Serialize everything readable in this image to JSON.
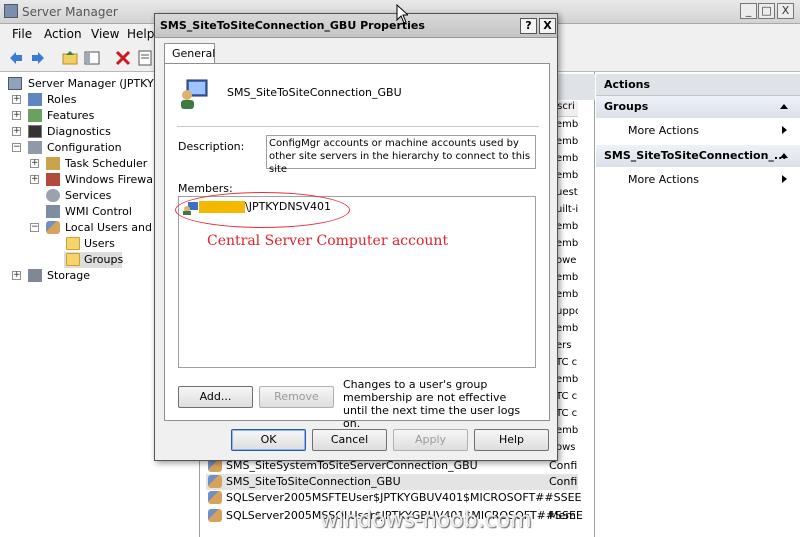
{
  "window": {
    "title": "Server Manager",
    "controls": {
      "minimize": "_",
      "maximize": "□",
      "close": "X"
    }
  },
  "menu": [
    "File",
    "Action",
    "View",
    "Help"
  ],
  "tree": {
    "root": "Server Manager (JPTKYGB",
    "items": {
      "roles": "Roles",
      "features": "Features",
      "diagnostics": "Diagnostics",
      "configuration": "Configuration",
      "task_scheduler": "Task Scheduler",
      "firewall": "Windows Firewall w",
      "services": "Services",
      "wmi": "WMI Control",
      "local_users": "Local Users and Gr",
      "users": "Users",
      "groups": "Groups",
      "storage": "Storage"
    }
  },
  "list": {
    "desc_header": "escri",
    "desc_cells": [
      "emb",
      "emb",
      "emb",
      "emb",
      "uest",
      "uilt-in",
      "emb",
      "emb",
      "owe",
      "emb",
      "emb",
      "uppo",
      "emb",
      "ers",
      "TC c",
      "emb",
      "TC c",
      "TC c",
      "emb",
      "ows"
    ],
    "rows": [
      {
        "name": "SMS_SiteSystemToSiteServerConnection_GBU",
        "desc": "Confi"
      },
      {
        "name": "SMS_SiteToSiteConnection_GBU",
        "desc": "Confi"
      },
      {
        "name": "SQLServer2005MSFTEUser$JPTKYGBUV401$MICROSOFT##SSEE",
        "desc": ""
      },
      {
        "name": "SQLServer2005MSSQLUser$JPTKYGBUV401$MICROSOFT##SSEE",
        "desc": "Memb"
      }
    ]
  },
  "actions": {
    "title": "Actions",
    "section1": "Groups",
    "section1_item": "More Actions",
    "section2": "SMS_SiteToSiteConnection_...",
    "section2_item": "More Actions"
  },
  "dialog": {
    "title": "SMS_SiteToSiteConnection_GBU Properties",
    "help_btn": "?",
    "close_btn": "X",
    "tab": "General",
    "group_name": "SMS_SiteToSiteConnection_GBU",
    "description_label": "Description:",
    "description_value": "ConfigMgr accounts or machine accounts used by other site servers in the hierarchy to connect to this site",
    "members_label": "Members:",
    "member": "\\JPTKYDNSV401",
    "add_button": "Add...",
    "remove_button": "Remove",
    "note": "Changes to a user's group membership are not effective until the next time the user logs on.",
    "ok_button": "OK",
    "cancel_button": "Cancel",
    "apply_button": "Apply",
    "help_button": "Help"
  },
  "annotation": "Central Server Computer account",
  "watermark": "windows-noob.com",
  "colors": {
    "annotation": "#e3202b",
    "redaction": "#f5b800"
  }
}
